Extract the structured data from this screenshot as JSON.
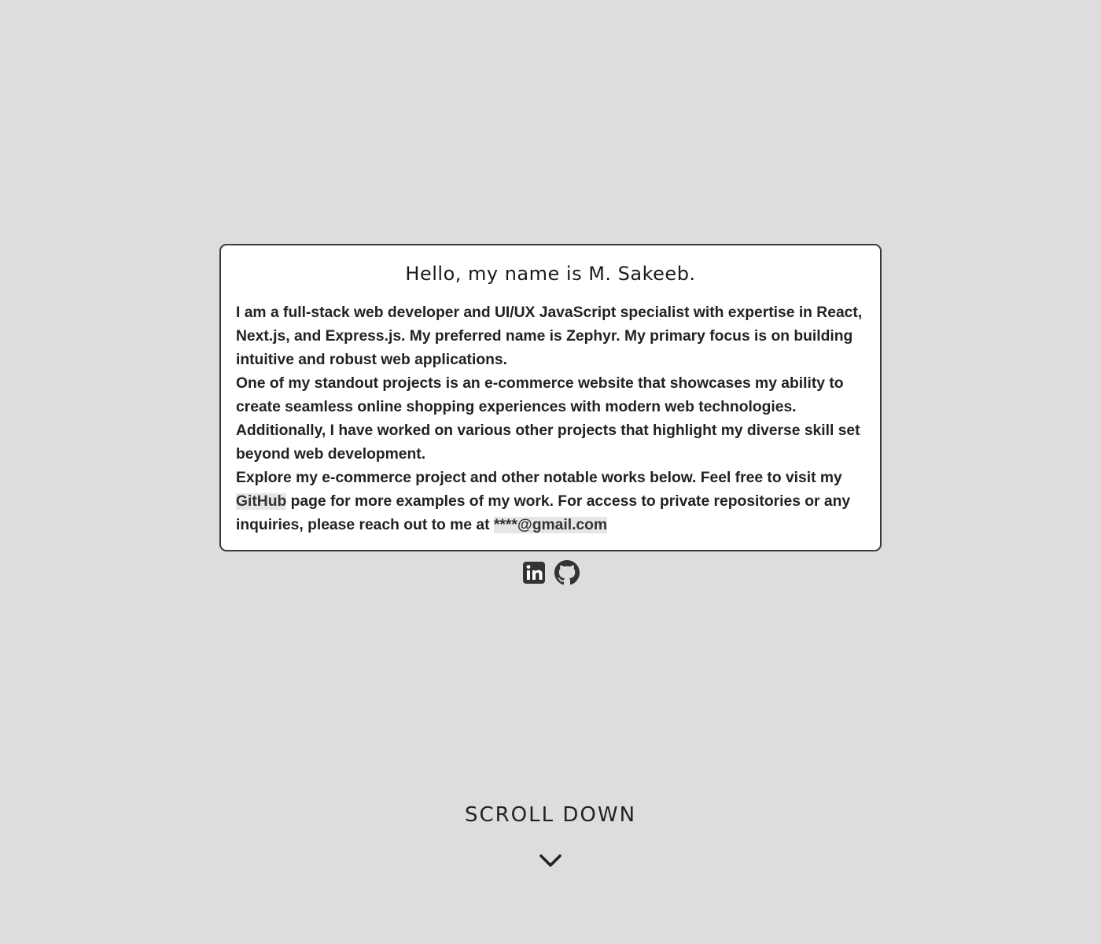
{
  "intro": {
    "title": "Hello, my name is M. Sakeeb.",
    "paragraph1": "I am a full-stack web developer and UI/UX JavaScript specialist with expertise in React, Next.js, and Express.js. My preferred name is Zephyr. My primary focus is on building intuitive and robust web applications.",
    "paragraph2": "One of my standout projects is an e-commerce website that showcases my ability to create seamless online shopping experiences with modern web technologies. Additionally, I have worked on various other projects that highlight my diverse skill set beyond web development.",
    "paragraph3_before": "Explore my e-commerce project and other notable works below. Feel free to visit my ",
    "github_link": "GitHub",
    "paragraph3_middle": " page for more examples of my work. For access to private repositories or any inquiries, please reach out to me at ",
    "email_link": "****@gmail.com"
  },
  "social": [
    {
      "icon": "linkedin-icon"
    },
    {
      "icon": "github-icon"
    }
  ],
  "scroll": {
    "label": "SCROLL DOWN",
    "icon": "chevron-down-icon"
  },
  "colors": {
    "background": "#dddddd",
    "card": "#ffffff",
    "text": "#222222",
    "link_highlight": "#e6e6e6"
  }
}
